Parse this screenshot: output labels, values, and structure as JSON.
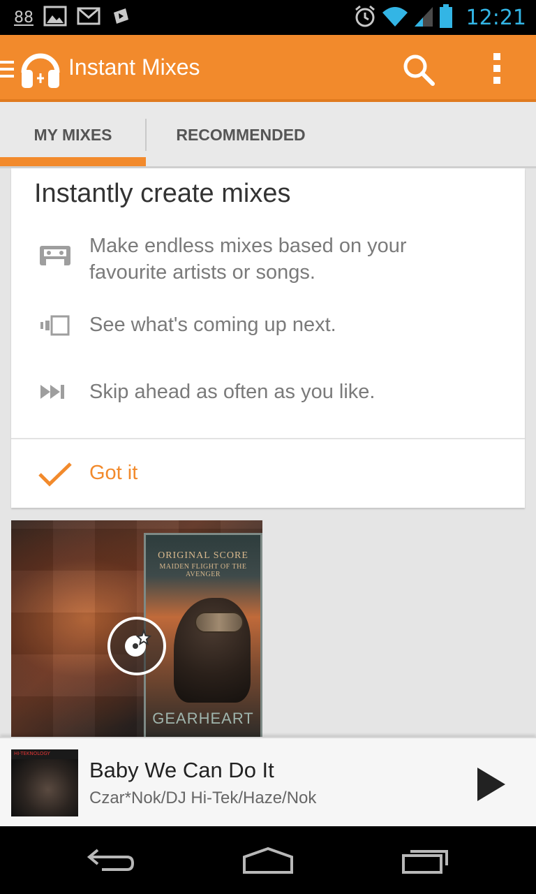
{
  "status_bar": {
    "notification_count": "88",
    "time": "12:21",
    "icons": [
      "picture-icon",
      "gmail-icon",
      "play-store-icon",
      "alarm-icon",
      "wifi-icon",
      "signal-icon",
      "battery-icon"
    ]
  },
  "action_bar": {
    "title": "Instant Mixes",
    "icons": [
      "drawer-icon",
      "headphones-logo-icon",
      "search-icon",
      "overflow-menu-icon"
    ]
  },
  "tabs": [
    {
      "label": "MY MIXES",
      "selected": true
    },
    {
      "label": "RECOMMENDED",
      "selected": false
    }
  ],
  "intro_card": {
    "title": "Instantly create mixes",
    "features": [
      {
        "icon": "cassette-icon",
        "text": "Make endless mixes based on your favourite artists or songs."
      },
      {
        "icon": "queue-icon",
        "text": "See what's coming up next."
      },
      {
        "icon": "skip-next-icon",
        "text": "Skip ahead as often as you like."
      }
    ],
    "dismiss_label": "Got it"
  },
  "mix_tile": {
    "album_line1": "ORIGINAL SCORE",
    "album_line2": "MAIDEN FLIGHT OF THE AVENGER",
    "album_brand": "GEARHEART"
  },
  "now_playing": {
    "title": "Baby We Can Do It",
    "artist": "Czar*Nok/DJ Hi-Tek/Haze/Nok",
    "art_label": "HI-TEKNOLOGY"
  },
  "colors": {
    "accent": "#f28a2c",
    "status_time": "#33b5e5"
  }
}
